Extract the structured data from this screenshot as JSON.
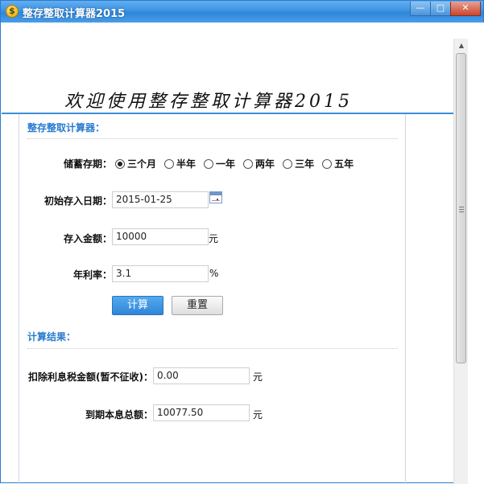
{
  "window": {
    "title": "整存整取计算器2015",
    "icon": "dollar-coin-icon",
    "controls": {
      "minimize": "—",
      "maximize": "□",
      "close": "✕"
    }
  },
  "banner": {
    "text": "欢迎使用整存整取计算器2015"
  },
  "calculator": {
    "section_title": "整存整取计算器：",
    "term_label": "储蓄存期：",
    "term_options": [
      "三个月",
      "半年",
      "一年",
      "两年",
      "三年",
      "五年"
    ],
    "term_selected": "三个月",
    "start_date_label": "初始存入日期：",
    "start_date_value": "2015-01-25",
    "amount_label": "存入金额：",
    "amount_value": "10000",
    "amount_unit": "元",
    "rate_label": "年利率：",
    "rate_value": "3.1",
    "rate_unit": "%",
    "calc_button": "计算",
    "reset_button": "重置"
  },
  "results": {
    "section_title": "计算结果：",
    "tax_label": "扣除利息税金额(暂不征收)：",
    "tax_value": "0.00",
    "tax_unit": "元",
    "total_label": "到期本息总额：",
    "total_value": "10077.50",
    "total_unit": "元"
  },
  "colors": {
    "accent": "#2a7bd0",
    "titlebar": "#3d93e2"
  }
}
